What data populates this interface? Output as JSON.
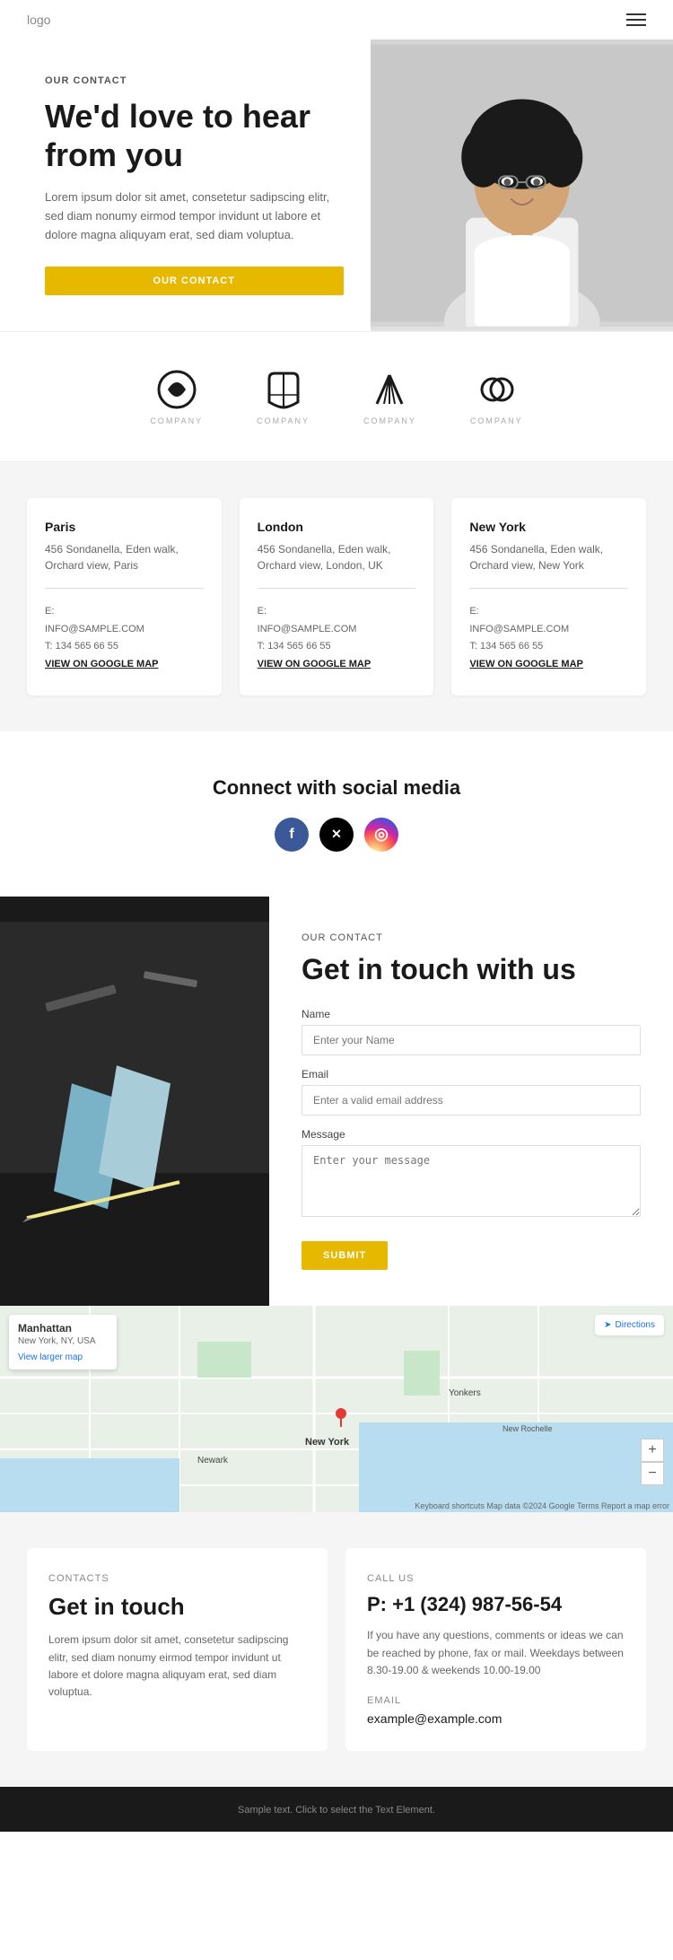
{
  "header": {
    "logo": "logo"
  },
  "hero": {
    "label": "OUR CONTACT",
    "title": "We'd love to hear from you",
    "description": "Lorem ipsum dolor sit amet, consetetur sadipscing elitr, sed diam nonumy eirmod tempor invidunt ut labore et dolore magna aliquyam erat, sed diam voluptua.",
    "button": "OUR CONTACT"
  },
  "logos": [
    {
      "id": "logo1",
      "text": "COMPANY"
    },
    {
      "id": "logo2",
      "text": "COMPANY"
    },
    {
      "id": "logo3",
      "text": "COMPANY"
    },
    {
      "id": "logo4",
      "text": "COMPANY"
    }
  ],
  "offices": [
    {
      "city": "Paris",
      "address": "456 Sondanella, Eden walk, Orchard view, Paris",
      "email_label": "E:",
      "email": "INFO@SAMPLE.COM",
      "phone": "T: 134 565 66 55",
      "map_link": "VIEW ON GOOGLE MAP"
    },
    {
      "city": "London",
      "address": "456 Sondanella, Eden walk, Orchard view, London, UK",
      "email_label": "E:",
      "email": "INFO@SAMPLE.COM",
      "phone": "T: 134 565 66 55",
      "map_link": "VIEW ON GOOGLE MAP"
    },
    {
      "city": "New York",
      "address": "456 Sondanella, Eden walk, Orchard view, New York",
      "email_label": "E:",
      "email": "INFO@SAMPLE.COM",
      "phone": "T: 134 565 66 55",
      "map_link": "VIEW ON GOOGLE MAP"
    }
  ],
  "social": {
    "title": "Connect with social media",
    "icons": [
      "f",
      "𝕏",
      "📷"
    ]
  },
  "contact_form": {
    "label": "OUR CONTACT",
    "title": "Get in touch with us",
    "name_label": "Name",
    "name_placeholder": "Enter your Name",
    "email_label": "Email",
    "email_placeholder": "Enter a valid email address",
    "message_label": "Message",
    "message_placeholder": "Enter your message",
    "submit": "SUBMIT"
  },
  "map": {
    "location": "Manhattan",
    "sub": "New York, NY, USA",
    "view_link": "View larger map",
    "directions": "Directions",
    "credit": "Keyboard shortcuts  Map data ©2024 Google  Terms  Report a map error",
    "zoom_in": "+",
    "zoom_out": "−"
  },
  "bottom_cards": [
    {
      "label": "CONTACTS",
      "title": "Get in touch",
      "description": "Lorem ipsum dolor sit amet, consetetur sadipscing elitr, sed diam nonumy eirmod tempor invidunt ut labore et dolore magna aliquyam erat, sed diam voluptua."
    },
    {
      "label": "CALL US",
      "phone": "P: +1 (324) 987-56-54",
      "call_description": "If you have any questions, comments or ideas we can be reached by phone, fax or mail. Weekdays between 8.30-19.00 & weekends 10.00-19.00",
      "email_label": "EMAIL",
      "email": "example@example.com"
    }
  ],
  "footer": {
    "text": "Sample text. Click to select the Text Element."
  }
}
